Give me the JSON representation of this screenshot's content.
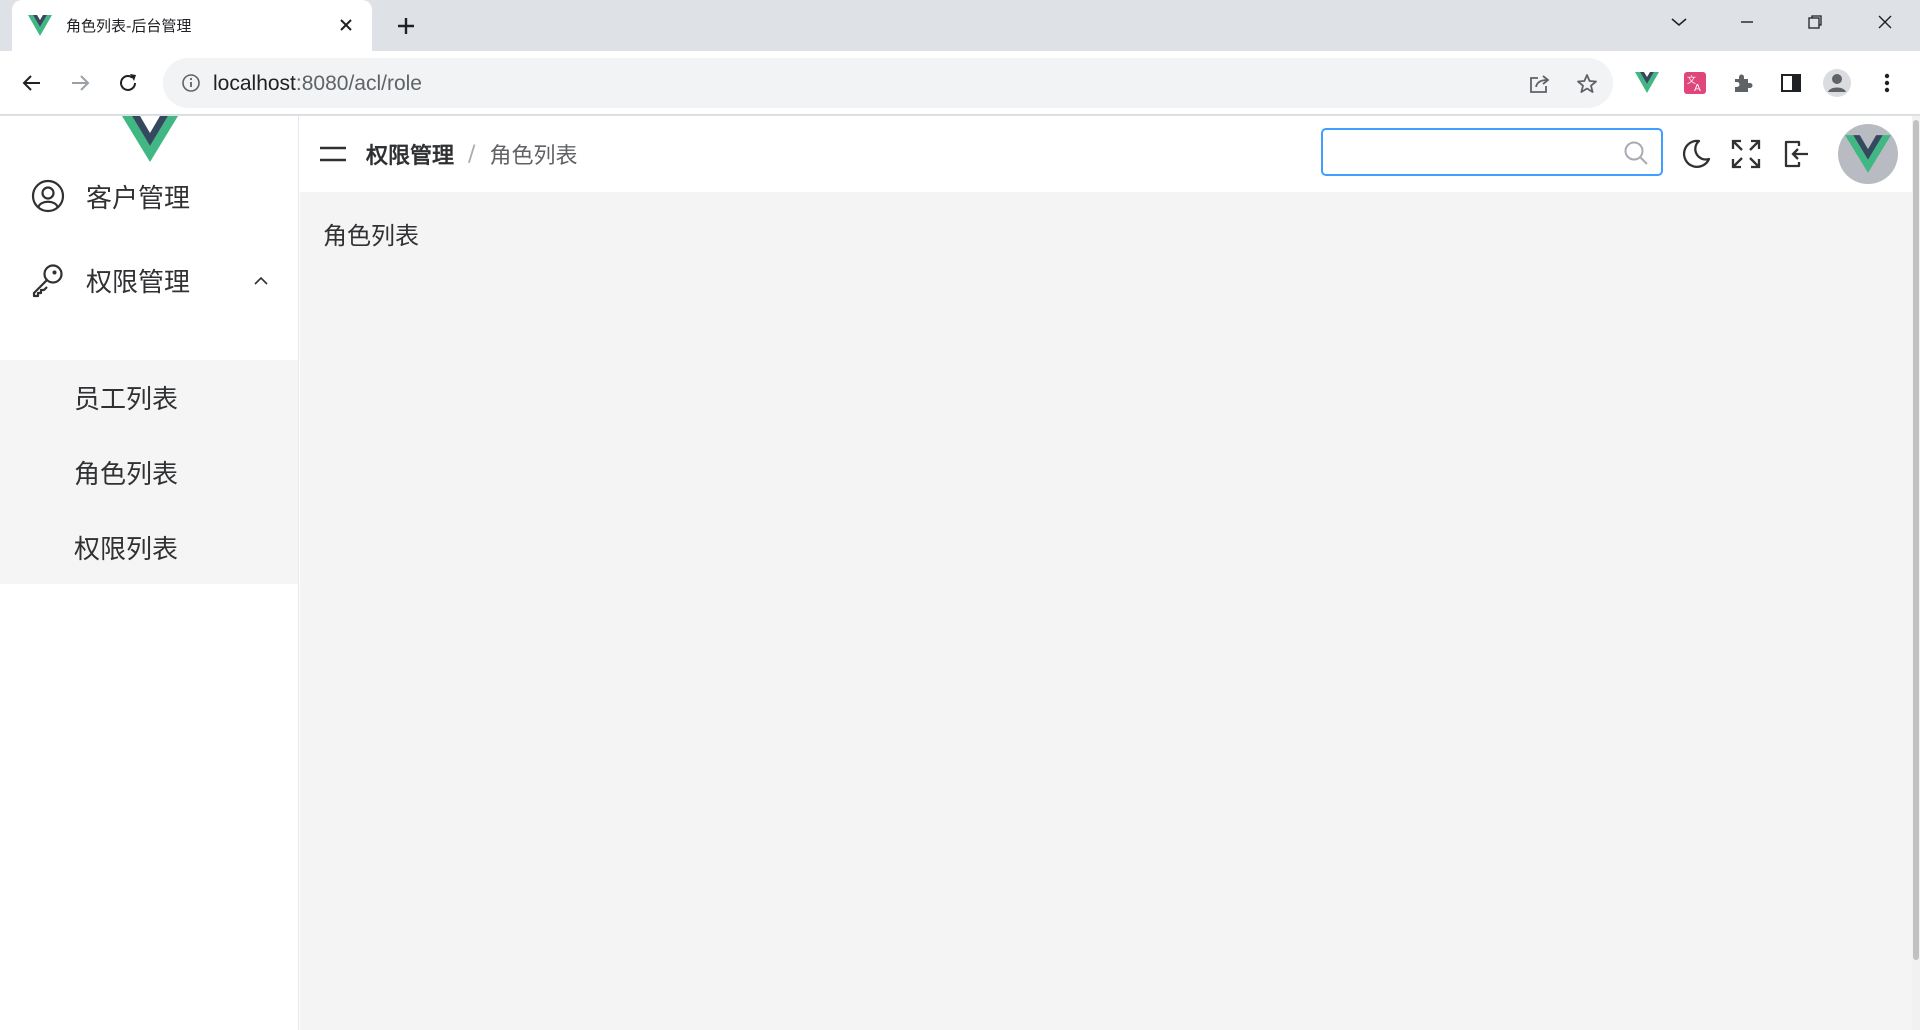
{
  "browser": {
    "tab_title": "角色列表-后台管理",
    "url_host": "localhost",
    "url_rest": ":8080/acl/role"
  },
  "sidebar": {
    "items": [
      {
        "label": "客户管理",
        "icon": "user-icon"
      },
      {
        "label": "权限管理",
        "icon": "key-icon",
        "expanded": true
      }
    ],
    "submenu": [
      {
        "label": "员工列表"
      },
      {
        "label": "角色列表",
        "active": true
      },
      {
        "label": "权限列表"
      }
    ]
  },
  "header": {
    "breadcrumb_parent": "权限管理",
    "breadcrumb_separator": "/",
    "breadcrumb_current": "角色列表",
    "search_value": ""
  },
  "main": {
    "title": "角色列表"
  },
  "colors": {
    "accent": "#409eff",
    "vue_green": "#41b883",
    "vue_dark": "#34495e"
  }
}
